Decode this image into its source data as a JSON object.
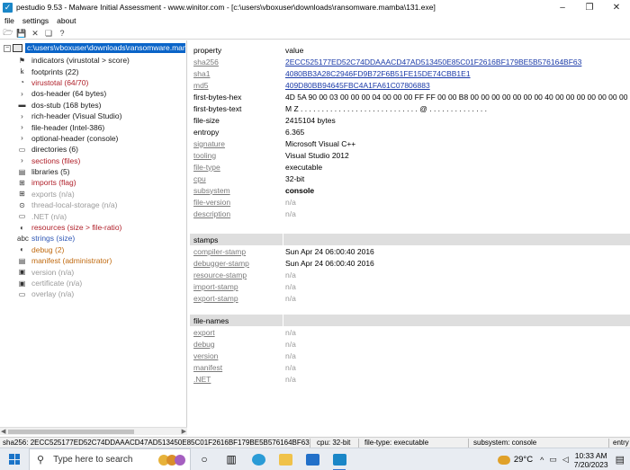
{
  "window": {
    "title": "pestudio 9.53 - Malware Initial Assessment - www.winitor.com - [c:\\users\\vboxuser\\downloads\\ransomware.mamba\\131.exe]",
    "minimize_glyph": "–",
    "maximize_glyph": "❐",
    "close_glyph": "✕"
  },
  "menu": [
    "file",
    "settings",
    "about"
  ],
  "toolbar": {
    "open_glyph": "🗁",
    "save_glyph": "💾",
    "close_glyph": "✕",
    "copy_glyph": "❏",
    "help_glyph": "?"
  },
  "tree": {
    "root": "c:\\users\\vboxuser\\downloads\\ransomware.mamba\\131.exe",
    "items": [
      {
        "label": "indicators (virustotal > score)",
        "icon": "⚑",
        "color": "dark"
      },
      {
        "label": "footprints (22)",
        "icon": "ꝃ",
        "color": "dark"
      },
      {
        "label": "virustotal (64/70)",
        "icon": "◔",
        "color": "red"
      },
      {
        "label": "dos-header (64 bytes)",
        "icon": "›",
        "color": "dark"
      },
      {
        "label": "dos-stub (168 bytes)",
        "icon": "▬",
        "color": "dark"
      },
      {
        "label": "rich-header (Visual Studio)",
        "icon": "›",
        "color": "dark"
      },
      {
        "label": "file-header (Intel-386)",
        "icon": "›",
        "color": "dark"
      },
      {
        "label": "optional-header (console)",
        "icon": "›",
        "color": "dark"
      },
      {
        "label": "directories (6)",
        "icon": "▭",
        "color": "dark"
      },
      {
        "label": "sections (files)",
        "icon": "›",
        "color": "red"
      },
      {
        "label": "libraries (5)",
        "icon": "▤",
        "color": "dark"
      },
      {
        "label": "imports (flag)",
        "icon": "⊞",
        "color": "red"
      },
      {
        "label": "exports (n/a)",
        "icon": "⊞",
        "color": "gray"
      },
      {
        "label": "thread-local-storage (n/a)",
        "icon": "⊙",
        "color": "gray"
      },
      {
        "label": ".NET (n/a)",
        "icon": "▭",
        "color": "gray"
      },
      {
        "label": "resources (size > file-ratio)",
        "icon": "◐",
        "color": "red"
      },
      {
        "label": "strings (size)",
        "icon": "abc",
        "color": "blue"
      },
      {
        "label": "debug (2)",
        "icon": "◐",
        "color": "orange"
      },
      {
        "label": "manifest (administrator)",
        "icon": "▤",
        "color": "orange"
      },
      {
        "label": "version (n/a)",
        "icon": "▣",
        "color": "gray"
      },
      {
        "label": "certificate (n/a)",
        "icon": "▣",
        "color": "gray"
      },
      {
        "label": "overlay (n/a)",
        "icon": "▭",
        "color": "gray"
      }
    ]
  },
  "table": {
    "header": {
      "property": "property",
      "value": "value"
    },
    "rows": [
      {
        "property": "sha256",
        "value": "2ECC525177ED52C74DDAAACD47AD513450E85C01F2616BF179BE5B576164BF63",
        "pstyle": "ulink",
        "vstyle": "hash"
      },
      {
        "property": "sha1",
        "value": "4080BB3A28C2946FD9B72F6B51FE15DE74CBB1E1",
        "pstyle": "ulink",
        "vstyle": "hash"
      },
      {
        "property": "md5",
        "value": "409D80BB94645FBC4A1FA61C07806883",
        "pstyle": "ulink",
        "vstyle": "hash"
      },
      {
        "property": "first-bytes-hex",
        "value": "4D 5A 90 00 03 00 00 00 04 00 00 00 FF FF 00 00 B8 00 00 00 00 00 00 00 40 00 00 00 00 00 00 00 00 00",
        "pstyle": "dark",
        "vstyle": "dark"
      },
      {
        "property": "first-bytes-text",
        "value": "M Z . . . . . . . . . . . . . . . . . . . . . . . . . . . . @ . . . . . . . . . . . . . .",
        "pstyle": "dark",
        "vstyle": "dark"
      },
      {
        "property": "file-size",
        "value": "2415104 bytes",
        "pstyle": "dark",
        "vstyle": "dark"
      },
      {
        "property": "entropy",
        "value": "6.365",
        "pstyle": "dark",
        "vstyle": "dark"
      },
      {
        "property": "signature",
        "value": "Microsoft Visual C++",
        "pstyle": "ulink",
        "vstyle": "dark"
      },
      {
        "property": "tooling",
        "value": "Visual Studio 2012",
        "pstyle": "ulink",
        "vstyle": "dark"
      },
      {
        "property": "file-type",
        "value": "executable",
        "pstyle": "ulink",
        "vstyle": "dark"
      },
      {
        "property": "cpu",
        "value": "32-bit",
        "pstyle": "ulink",
        "vstyle": "dark"
      },
      {
        "property": "subsystem",
        "value": "console",
        "pstyle": "ulink",
        "vstyle": "bold"
      },
      {
        "property": "file-version",
        "value": "n/a",
        "pstyle": "ulink",
        "vstyle": "gray"
      },
      {
        "property": "description",
        "value": "n/a",
        "pstyle": "ulink",
        "vstyle": "gray"
      }
    ],
    "stamps_header": "stamps",
    "stamps": [
      {
        "property": "compiler-stamp",
        "value": "Sun Apr 24 06:00:40 2016",
        "vstyle": "dark"
      },
      {
        "property": "debugger-stamp",
        "value": "Sun Apr 24 06:00:40 2016",
        "vstyle": "dark"
      },
      {
        "property": "resource-stamp",
        "value": "n/a",
        "vstyle": "gray"
      },
      {
        "property": "import-stamp",
        "value": "n/a",
        "vstyle": "gray"
      },
      {
        "property": "export-stamp",
        "value": "n/a",
        "vstyle": "gray"
      }
    ],
    "filenames_header": "file-names",
    "filenames": [
      {
        "property": "export",
        "value": "n/a"
      },
      {
        "property": "debug",
        "value": "n/a"
      },
      {
        "property": "version",
        "value": "n/a"
      },
      {
        "property": "manifest",
        "value": "n/a"
      },
      {
        "property": ".NET",
        "value": "n/a"
      }
    ]
  },
  "statusbar": {
    "sha256": "sha256: 2ECC525177ED52C74DDAAACD47AD513450E85C01F2616BF179BE5B576164BF63",
    "cpu": "cpu: 32-bit",
    "file_type": "file-type: executable",
    "subsystem": "subsystem: console",
    "entry": "entry"
  },
  "taskbar": {
    "search_placeholder": "Type here to search",
    "weather": "29°C",
    "time": "10:33 AM",
    "date": "7/20/2023",
    "chevron": "^"
  }
}
